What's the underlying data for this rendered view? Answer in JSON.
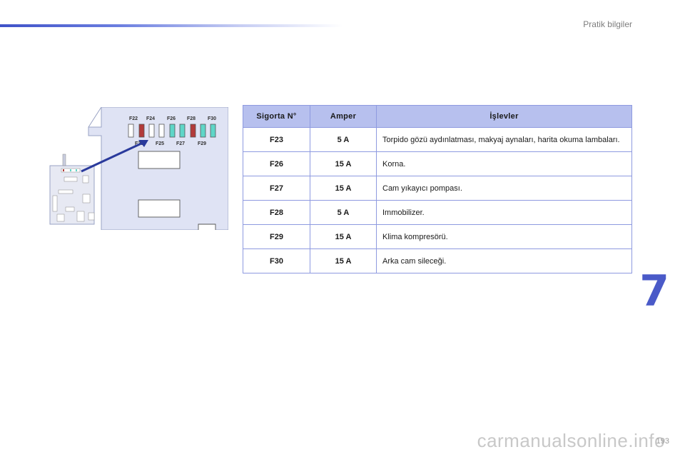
{
  "header": {
    "section_title": "Pratik bilgiler"
  },
  "chapter_number": "7",
  "page_number": "193",
  "watermark": "carmanualsonline.info",
  "diagram": {
    "top_labels": [
      "F22",
      "F24",
      "F26",
      "F28",
      "F30"
    ],
    "bottom_labels": [
      "F23",
      "F25",
      "F27",
      "F29"
    ],
    "fuse_colors": {
      "empty": "#ffffff",
      "red": "#b23a3a",
      "cyan": "#5fd6c8",
      "panel": "#dfe3f4"
    }
  },
  "table": {
    "headers": [
      "Sigorta N°",
      "Amper",
      "İşlevler"
    ],
    "rows": [
      {
        "fuse": "F23",
        "amp": "5 A",
        "func": "Torpido gözü aydınlatması, makyaj aynaları, harita okuma lambaları."
      },
      {
        "fuse": "F26",
        "amp": "15 A",
        "func": "Korna."
      },
      {
        "fuse": "F27",
        "amp": "15 A",
        "func": "Cam yıkayıcı pompası."
      },
      {
        "fuse": "F28",
        "amp": "5 A",
        "func": "Immobilizer."
      },
      {
        "fuse": "F29",
        "amp": "15 A",
        "func": "Klima kompresörü."
      },
      {
        "fuse": "F30",
        "amp": "15 A",
        "func": "Arka cam sileceği."
      }
    ]
  }
}
